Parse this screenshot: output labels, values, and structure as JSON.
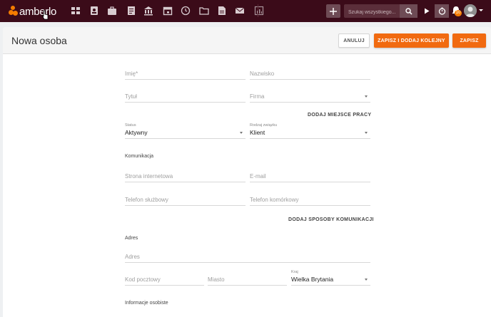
{
  "nav": {
    "logo_text": "amberlo",
    "icons": [
      "dashboard-icon",
      "contacts-icon",
      "briefcase-icon",
      "document-icon",
      "bank-icon",
      "calendar-icon",
      "time-money-icon",
      "folder-icon",
      "file-icon",
      "mail-icon",
      "report-icon"
    ],
    "search_placeholder": "Szukaj wszystkiego...",
    "notification_count": "10",
    "brand_color": "#3b0b19",
    "accent_color": "#f16a10"
  },
  "header": {
    "title": "Nowa osoba",
    "cancel_label": "ANULUJ",
    "save_add_label": "ZAPISZ I DODAJ KOLEJNY",
    "save_label": "ZAPISZ"
  },
  "form": {
    "first_name_placeholder": "Imię*",
    "last_name_placeholder": "Nazwisko",
    "title_placeholder": "Tytuł",
    "company_placeholder": "Firma",
    "add_workplace_label": "DODAJ MIEJSCE PRACY",
    "status_label": "Status",
    "status_value": "Aktywny",
    "relation_label": "Rodzaj związku",
    "relation_value": "Klient",
    "communication_heading": "Komunikacja",
    "website_placeholder": "Strona internetowa",
    "email_placeholder": "E-mail",
    "work_phone_placeholder": "Telefon służbowy",
    "mobile_phone_placeholder": "Telefon komórkowy",
    "add_communication_label": "DODAJ SPOSOBY KOMUNIKACJI",
    "address_heading": "Adres",
    "address_placeholder": "Adres",
    "postal_code_placeholder": "Kod pocztowy",
    "city_placeholder": "Miasto",
    "country_label": "Kraj",
    "country_value": "Wielka Brytania",
    "personal_info_heading": "Informacje osobiste"
  }
}
